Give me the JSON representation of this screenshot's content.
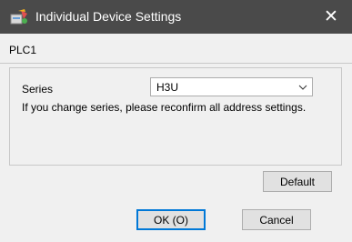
{
  "window": {
    "title": "Individual Device Settings",
    "close_symbol": "✕",
    "icon": "device-settings-icon"
  },
  "tab": {
    "label": "PLC1"
  },
  "series": {
    "label": "Series",
    "selected": "H3U"
  },
  "notice": "If you change series, please reconfirm all address settings.",
  "buttons": {
    "default": "Default",
    "ok": "OK (O)",
    "cancel": "Cancel"
  },
  "colors": {
    "titlebar": "#4a4a4a",
    "focus_border": "#0078d7"
  }
}
